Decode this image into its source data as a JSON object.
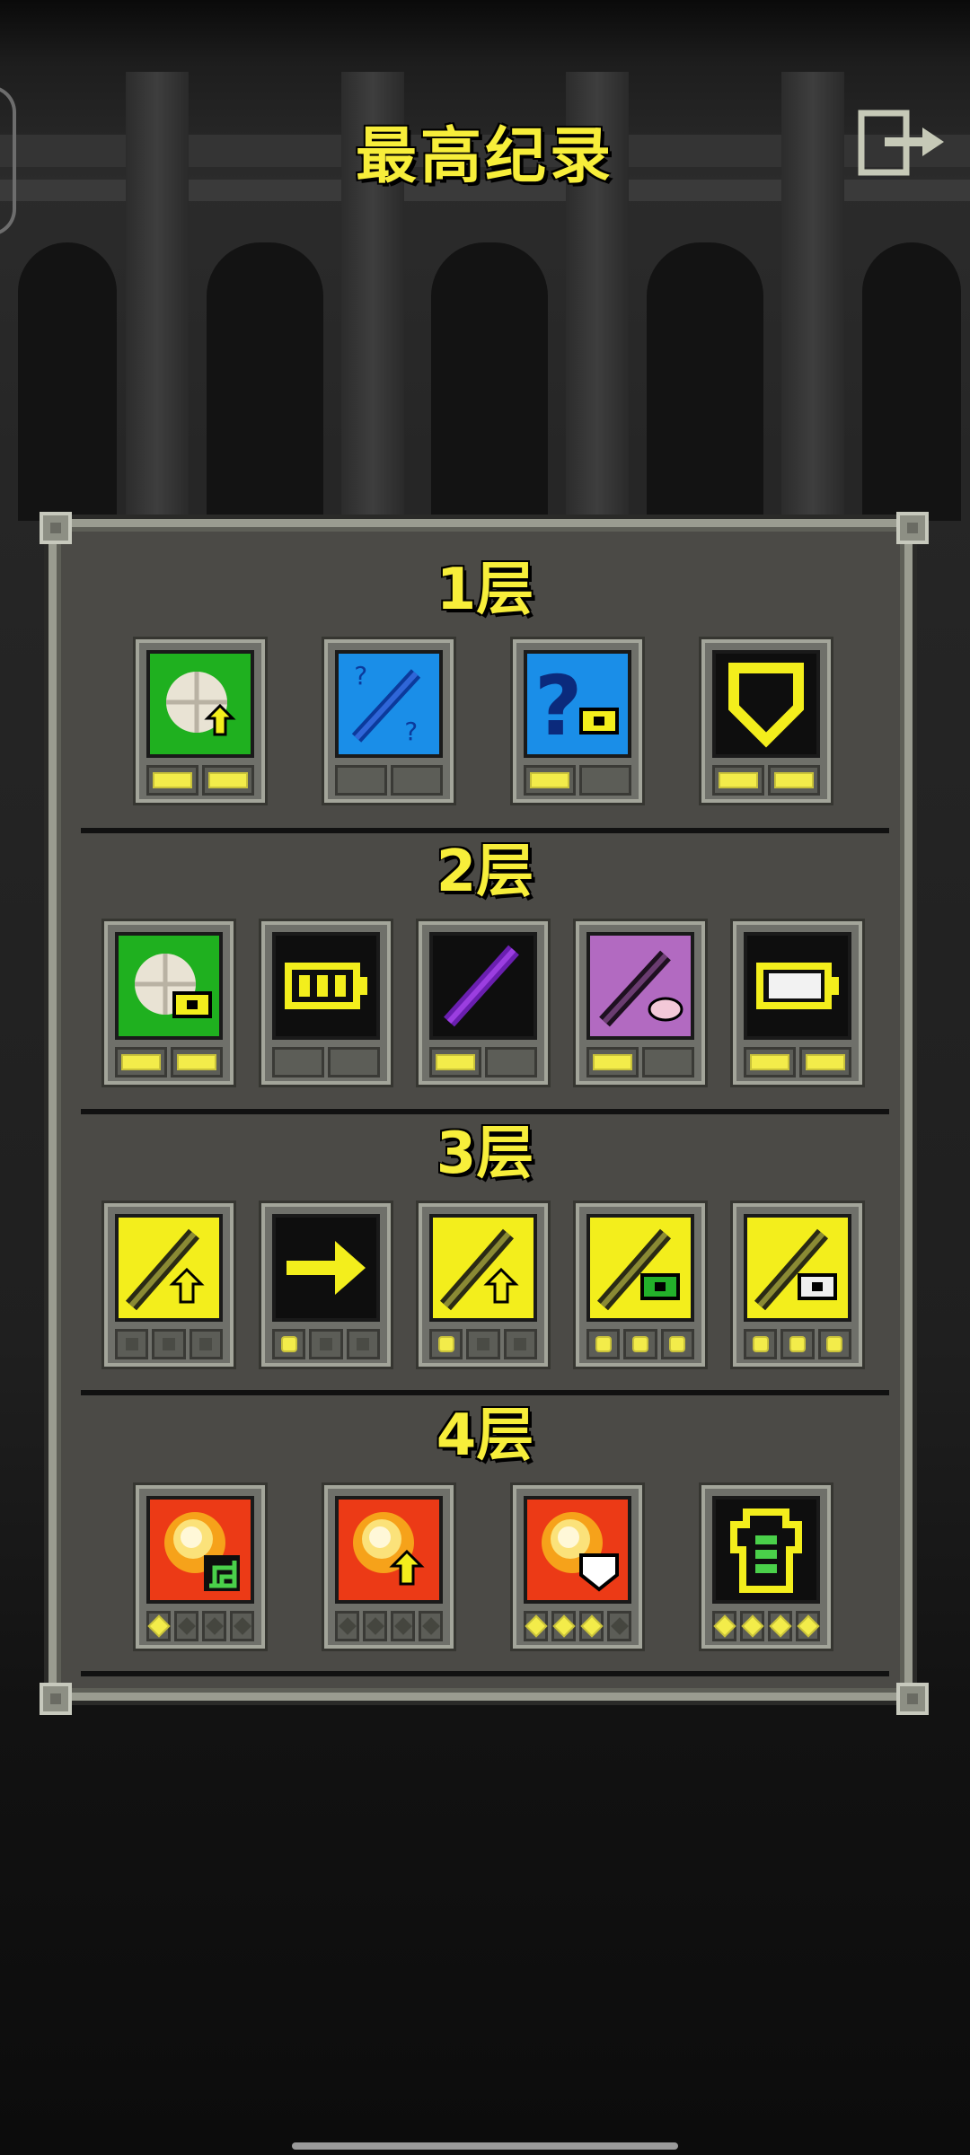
{
  "title": "最高纪录",
  "exit_icon": "exit-door-icon",
  "colors": {
    "accent_text": "#f7ee3a",
    "panel": "#4b4a46",
    "panel_border": "#9a9c90"
  },
  "floors": [
    {
      "label": "1层",
      "items": [
        {
          "icon": "seed-upgrade-icon",
          "bg": "#1fb01f",
          "slots": [
            1,
            1
          ]
        },
        {
          "icon": "wand-unknown-icon",
          "bg": "#1a8ee8",
          "slots": [
            0,
            0
          ]
        },
        {
          "icon": "unknown-ring-icon",
          "bg": "#1a8ee8",
          "slots": [
            1,
            0
          ]
        },
        {
          "icon": "armor-icon",
          "bg": "#0e0e0e",
          "slots": [
            1,
            1
          ]
        }
      ]
    },
    {
      "label": "2层",
      "items": [
        {
          "icon": "seed-ring-icon",
          "bg": "#1fb01f",
          "slots": [
            1,
            1
          ]
        },
        {
          "icon": "battery-full-icon",
          "bg": "#0e0e0e",
          "slots": [
            0,
            0
          ]
        },
        {
          "icon": "purple-wand-icon",
          "bg": "#0e0e0e",
          "slots": [
            1,
            0
          ]
        },
        {
          "icon": "wand-pink-icon",
          "bg": "#b26ac1",
          "slots": [
            1,
            0
          ]
        },
        {
          "icon": "battery-white-icon",
          "bg": "#0e0e0e",
          "slots": [
            1,
            1
          ]
        }
      ]
    },
    {
      "label": "3层",
      "items": [
        {
          "icon": "weapon-upgrade-icon",
          "bg": "#f3ee1c",
          "slots": [
            0,
            0,
            0
          ]
        },
        {
          "icon": "arrow-right-icon",
          "bg": "#0e0e0e",
          "slots": [
            1,
            0,
            0
          ]
        },
        {
          "icon": "weapon-upgrade-icon",
          "bg": "#f3ee1c",
          "slots": [
            1,
            0,
            0
          ]
        },
        {
          "icon": "weapon-green-ring-icon",
          "bg": "#f3ee1c",
          "slots": [
            1,
            1,
            1
          ]
        },
        {
          "icon": "weapon-white-ring-icon",
          "bg": "#f3ee1c",
          "slots": [
            1,
            1,
            1
          ]
        }
      ]
    },
    {
      "label": "4层",
      "items": [
        {
          "icon": "explosion-stairs-icon",
          "bg": "#ec3a16",
          "slots": [
            1,
            0,
            0,
            0
          ]
        },
        {
          "icon": "explosion-upgrade-icon",
          "bg": "#ec3a16",
          "slots": [
            0,
            0,
            0,
            0
          ]
        },
        {
          "icon": "explosion-shield-icon",
          "bg": "#ec3a16",
          "slots": [
            1,
            1,
            1,
            0
          ]
        },
        {
          "icon": "armor-outline-icon",
          "bg": "#0e0e0e",
          "slots": [
            1,
            1,
            1,
            1
          ]
        }
      ]
    }
  ]
}
